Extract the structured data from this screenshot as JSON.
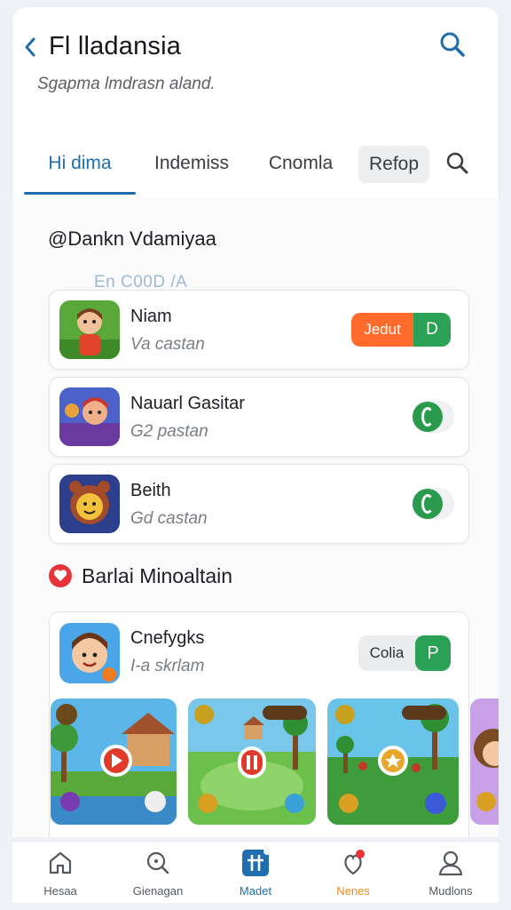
{
  "header": {
    "title": "Fl lladansia",
    "subtitle": "Sgapma lmdrasn aland."
  },
  "tabs": [
    {
      "label": "Hi dima",
      "active": true
    },
    {
      "label": "Indemiss",
      "active": false
    },
    {
      "label": "Cnomla",
      "active": false
    },
    {
      "label": "Refop",
      "active": false
    }
  ],
  "section1": {
    "title": "@Dankn Vdamiyaa",
    "faded_label": "En C00D /A"
  },
  "games": [
    {
      "name": "Niam",
      "subtitle": "Va castan",
      "control": "button",
      "button_left": "Jedut",
      "button_right": "D"
    },
    {
      "name": "Nauarl Gasitar",
      "subtitle": "G2 pastan",
      "control": "toggle",
      "on": true
    },
    {
      "name": "Beith",
      "subtitle": "Gd castan",
      "control": "toggle",
      "on": true
    }
  ],
  "section2": {
    "title": "Barlai Minoaltain"
  },
  "featured": {
    "name": "Cnefygks",
    "subtitle": "I-a skrlam",
    "button_left": "Colia",
    "button_right": "P"
  },
  "colors": {
    "accent": "#1f6fb0",
    "green": "#2aa154",
    "orange": "#ff6b2a",
    "heart": "#e8333a"
  },
  "bottom_nav": [
    {
      "label": "Hesaa",
      "icon": "home-icon"
    },
    {
      "label": "Gienagan",
      "icon": "search-icon"
    },
    {
      "label": "Madet",
      "icon": "grid-icon",
      "active": true
    },
    {
      "label": "Nenes",
      "icon": "notification-icon",
      "badge": true
    },
    {
      "label": "Mudlons",
      "icon": "profile-icon"
    }
  ]
}
